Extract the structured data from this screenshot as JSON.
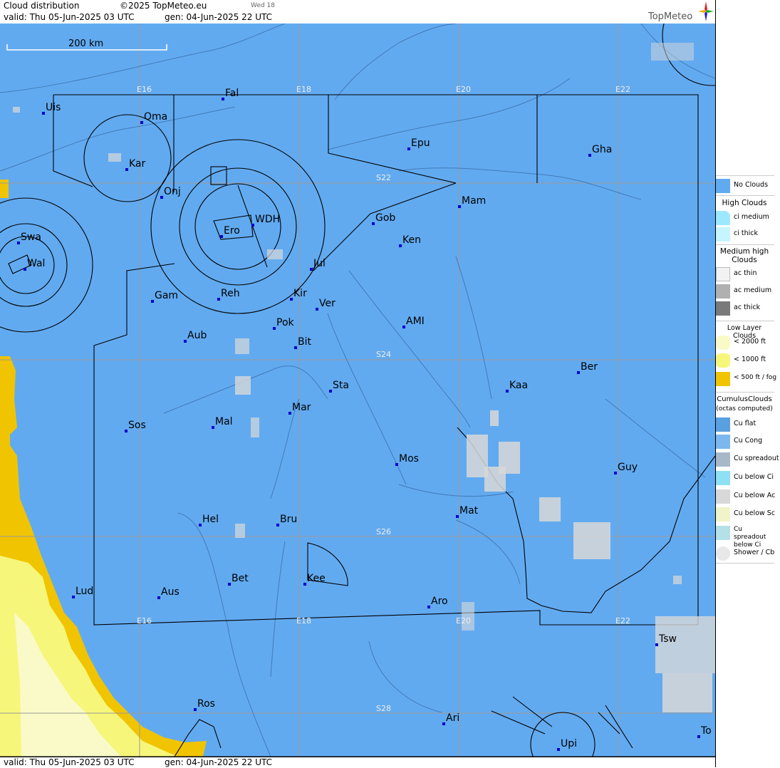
{
  "header": {
    "title": "Cloud distribution",
    "copyright": "©2025 TopMeteo.eu",
    "day_label": "Wed 18",
    "valid": "valid:  Thu  05-Jun-2025  03 UTC",
    "gen": "gen: 04-Jun-2025 22 UTC",
    "brand": "TopMeteo"
  },
  "footer": {
    "valid": "valid:  Thu  05-Jun-2025  03 UTC",
    "gen": "gen: 04-Jun-2025 22 UTC"
  },
  "map": {
    "scale_label": "200 km",
    "grid_labels": [
      "E16",
      "E18",
      "E20",
      "E22",
      "E16",
      "E18",
      "E20",
      "E22",
      "S22",
      "S24",
      "S26",
      "S28"
    ],
    "cities": [
      "Uis",
      "Fal",
      "Oma",
      "Kar",
      "Epu",
      "Gha",
      "Onj",
      "WDH",
      "Ero",
      "Swa",
      "Wal",
      "Mam",
      "Gob",
      "Ken",
      "Jul",
      "Gam",
      "Reh",
      "Kir",
      "Ver",
      "AMI",
      "Pok",
      "Aub",
      "Bit",
      "Ber",
      "Sta",
      "Kaa",
      "Mar",
      "Sos",
      "Mal",
      "Mos",
      "Guy",
      "Mat",
      "Hel",
      "Bru",
      "Bet",
      "Kee",
      "Lud",
      "Aus",
      "Aro",
      "Tsw",
      "Ros",
      "Ari",
      "Upi",
      "To"
    ]
  },
  "legend": {
    "no_clouds": "No Clouds",
    "high_title": "High Clouds",
    "ci_medium": "ci medium",
    "ci_thick": "ci thick",
    "medium_title": "Medium high Clouds",
    "ac_thin": "ac thin",
    "ac_medium": "ac medium",
    "ac_thick": "ac thick",
    "low_title": "Low Layer Clouds",
    "low_2000": "< 2000 ft",
    "low_1000": "< 1000 ft",
    "low_500": "< 500 ft / fog",
    "cu_title": "CumulusClouds",
    "cu_sub": "(octas computed)",
    "cu_flat": "Cu flat",
    "cu_cong": "Cu Cong",
    "cu_spread": "Cu spreadout",
    "cu_below_ci": "Cu below Ci",
    "cu_below_ac": "Cu below Ac",
    "cu_below_sc": "Cu below Sc",
    "cu_spread_ci": "Cu spreadout below Ci",
    "shower": "Shower / Cb"
  },
  "colors": {
    "sea_land": "#62aaf0",
    "fog": "#f0c400",
    "low1000": "#f6f67a",
    "low2000": "#fafac8",
    "grid": "#9a9a9a",
    "city_marker": "#0000cc"
  }
}
